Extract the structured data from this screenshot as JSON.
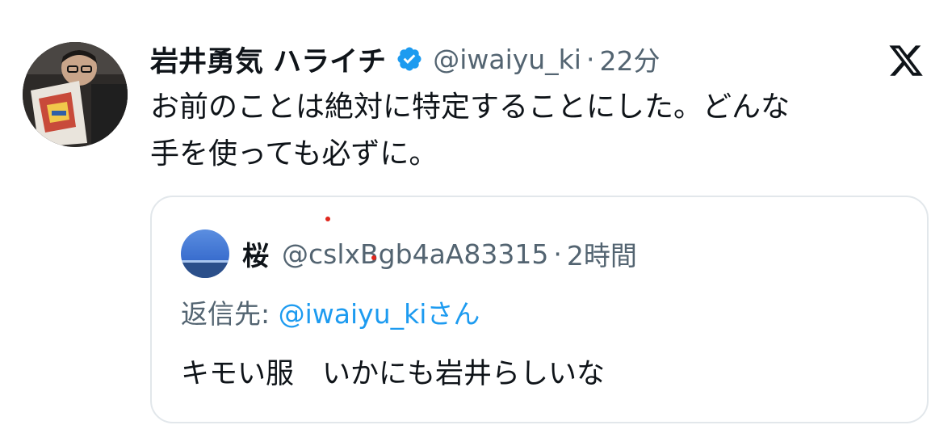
{
  "tweet": {
    "display_name": "岩井勇気 ハライチ",
    "verified": true,
    "handle": "@iwaiyu_ki",
    "separator": "·",
    "time": "22分",
    "text_lines": [
      "お前のことは絶対に特定することにした。どんな",
      "手を使っても必ずに。"
    ]
  },
  "brand": {
    "logo": "x-logo-icon"
  },
  "quoted_tweet": {
    "display_name": "桜",
    "handle": "@cslxBgb4aA83315",
    "separator": "·",
    "time": "2時間",
    "reply_label": "返信先: ",
    "reply_mention": "@iwaiyu_ki",
    "reply_suffix": "さん",
    "text": "キモい服　いかにも岩井らしいな"
  },
  "colors": {
    "text_primary": "#0f1419",
    "text_secondary": "#536471",
    "accent": "#1d9bf0",
    "border": "#e2e7eb",
    "verified_badge": "#1d9bf0"
  }
}
